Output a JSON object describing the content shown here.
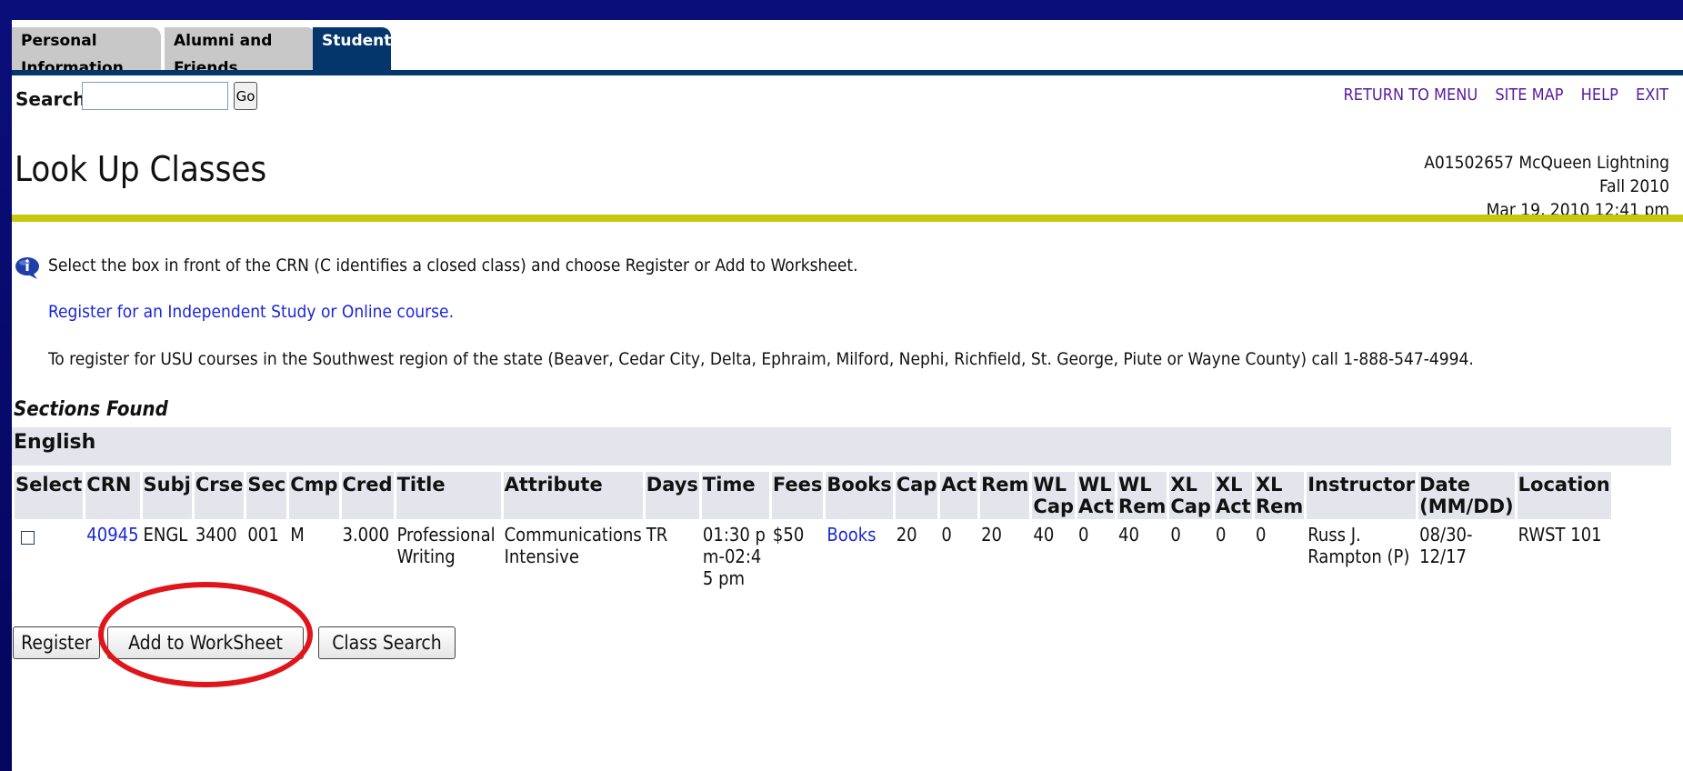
{
  "tabs": [
    {
      "label": "Personal Information",
      "active": false
    },
    {
      "label": "Alumni and Friends",
      "active": false
    },
    {
      "label": "Student",
      "active": true
    }
  ],
  "search": {
    "label": "Search",
    "value": "",
    "go_label": "Go"
  },
  "top_links": [
    "RETURN TO MENU",
    "SITE MAP",
    "HELP",
    "EXIT"
  ],
  "page_title": "Look Up Classes",
  "user_info": {
    "id_name": "A01502657 McQueen Lightning",
    "term": "Fall 2010",
    "datetime": "Mar 19, 2010 12:41 pm"
  },
  "messages": {
    "select": "Select the box in front of the CRN (C identifies a closed class) and choose Register or Add to Worksheet.",
    "independent_link": "Register for an Independent Study or Online course.",
    "southwest": "To register for USU courses in the Southwest region of the state (Beaver, Cedar City, Delta, Ephraim, Milford, Nephi, Richfield, St. George, Piute or Wayne County) call 1-888-547-4994."
  },
  "sections_found": "Sections Found",
  "subject": "English",
  "columns": [
    "Select",
    "CRN",
    "Subj",
    "Crse",
    "Sec",
    "Cmp",
    "Cred",
    "Title",
    "Attribute",
    "Days",
    "Time",
    "Fees",
    "Books",
    "Cap",
    "Act",
    "Rem",
    "WL Cap",
    "WL Act",
    "WL Rem",
    "XL Cap",
    "XL Act",
    "XL Rem",
    "Instructor",
    "Date (MM/DD)",
    "Location"
  ],
  "row": {
    "crn": "40945",
    "subj": "ENGL",
    "crse": "3400",
    "sec": "001",
    "cmp": "M",
    "cred": "3.000",
    "title": "Professional Writing",
    "attribute": "Communications Intensive",
    "days": "TR",
    "time": "01:30 pm-02:45 pm",
    "fees": "$50",
    "books": "Books",
    "cap": "20",
    "act": "0",
    "rem": "20",
    "wl_cap": "40",
    "wl_act": "0",
    "wl_rem": "40",
    "xl_cap": "0",
    "xl_act": "0",
    "xl_rem": "0",
    "instructor": "Russ J. Rampton (P)",
    "date": "08/30-12/17",
    "location": "RWST 101"
  },
  "buttons": {
    "register": "Register",
    "add_worksheet": "Add to WorkSheet",
    "class_search": "Class Search"
  },
  "colors": {
    "frame": "#04086a",
    "tab_active": "#05366b",
    "accent_bar": "#c6c80e",
    "link": "#1a27d9",
    "highlight": "#e0151b"
  }
}
